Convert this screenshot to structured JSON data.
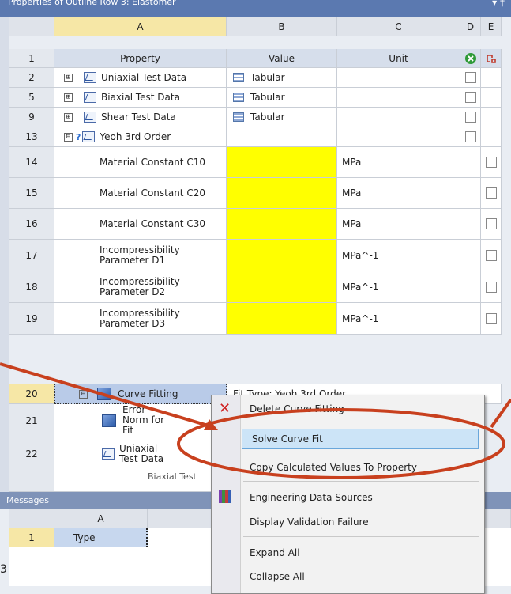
{
  "window_title": "Properties of Outline Row 3: Elastomer",
  "window_controls": "▾ †",
  "columns": {
    "num": "",
    "a": "A",
    "b": "B",
    "c": "C",
    "d": "D",
    "e": "E"
  },
  "header_row": {
    "num": "1",
    "property": "Property",
    "value": "Value",
    "unit": "Unit"
  },
  "rows": [
    {
      "num": "2",
      "label": "Uniaxial Test Data",
      "value": "Tabular",
      "unit": ""
    },
    {
      "num": "5",
      "label": "Biaxial Test Data",
      "value": "Tabular",
      "unit": ""
    },
    {
      "num": "9",
      "label": "Shear Test Data",
      "value": "Tabular",
      "unit": ""
    },
    {
      "num": "13",
      "label": "Yeoh 3rd Order",
      "value": "",
      "unit": ""
    },
    {
      "num": "14",
      "label": "Material Constant C10",
      "value": "",
      "unit": "MPa"
    },
    {
      "num": "15",
      "label": "Material Constant C20",
      "value": "",
      "unit": "MPa"
    },
    {
      "num": "16",
      "label": "Material Constant C30",
      "value": "",
      "unit": "MPa"
    },
    {
      "num": "17",
      "label": "Incompressibility Parameter D1",
      "value": "",
      "unit": "MPa^-1"
    },
    {
      "num": "18",
      "label": "Incompressibility Parameter D2",
      "value": "",
      "unit": "MPa^-1"
    },
    {
      "num": "19",
      "label": "Incompressibility Parameter D3",
      "value": "",
      "unit": "MPa^-1"
    },
    {
      "num": "20",
      "label": "Curve Fitting",
      "value": "Fit Type: Yeoh 3rd Order",
      "unit": ""
    },
    {
      "num": "21",
      "label": "Error Norm for Fit",
      "value": "",
      "unit": ""
    },
    {
      "num": "22",
      "label": "Uniaxial Test Data",
      "value": "",
      "unit": ""
    }
  ],
  "collapse_glyph": "⊟",
  "expand_glyph": "⊞",
  "partial_row": "Biaxial Test",
  "messages": {
    "title": "Messages",
    "col_a": "A",
    "row_num": "1",
    "type_label": "Type",
    "edge_char": "3"
  },
  "context_menu": {
    "items": [
      "Delete Curve Fitting",
      "Solve Curve Fit",
      "Copy Calculated Values To Property",
      "Engineering Data Sources",
      "Display Validation Failure",
      "Expand All",
      "Collapse All"
    ],
    "highlighted": "Solve Curve Fit"
  },
  "colors": {
    "annotation": "#c8401e",
    "highlight_value": "#ffff00",
    "selection": "#b9cbe8"
  }
}
